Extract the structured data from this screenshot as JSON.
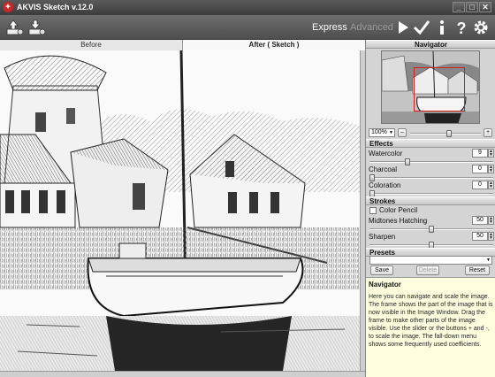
{
  "window": {
    "title": "AKVIS Sketch v.12.0",
    "minimize": "_",
    "restore": "□",
    "close": "✕"
  },
  "toolbar": {
    "open_icon": "open-file-icon",
    "save_icon": "save-file-icon",
    "mode_express": "Express",
    "mode_advanced": "Advanced",
    "run_icon": "play-icon",
    "apply_icon": "checkmark-icon",
    "info_icon": "info-icon",
    "help_icon": "question-icon",
    "settings_icon": "gear-icon"
  },
  "tabs": {
    "before": "Before",
    "after": "After ( Sketch )"
  },
  "navigator": {
    "title": "Navigator",
    "zoom": "100%",
    "zoom_out": "–",
    "zoom_in": "+",
    "zoom_level": 0.55
  },
  "effects": {
    "title": "Effects",
    "watercolor": {
      "label": "Watercolor",
      "value": "9",
      "level": 0.3
    },
    "charcoal": {
      "label": "Charcoal",
      "value": "0",
      "level": 0
    },
    "coloration": {
      "label": "Coloration",
      "value": "0",
      "level": 0
    }
  },
  "strokes": {
    "title": "Strokes",
    "color_pencil": "Color Pencil",
    "midtones": {
      "label": "Midtones Hatching",
      "value": "50",
      "level": 0.5
    },
    "sharpen": {
      "label": "Sharpen",
      "value": "50",
      "level": 0.5
    }
  },
  "presets": {
    "title": "Presets",
    "save": "Save",
    "delete": "Delete",
    "reset": "Reset"
  },
  "help": {
    "title": "Navigator",
    "text": "Here you can navigate and scale the image. The frame shows the part of the image that is now visible in the Image Window. Drag the frame to make other parts of the image visible. Use the slider or the buttons + and -, to scale the image. The fall-down menu shows some frequently used coefficients."
  },
  "colors": {
    "accent": "#c62828",
    "frame": "#cc2222"
  }
}
